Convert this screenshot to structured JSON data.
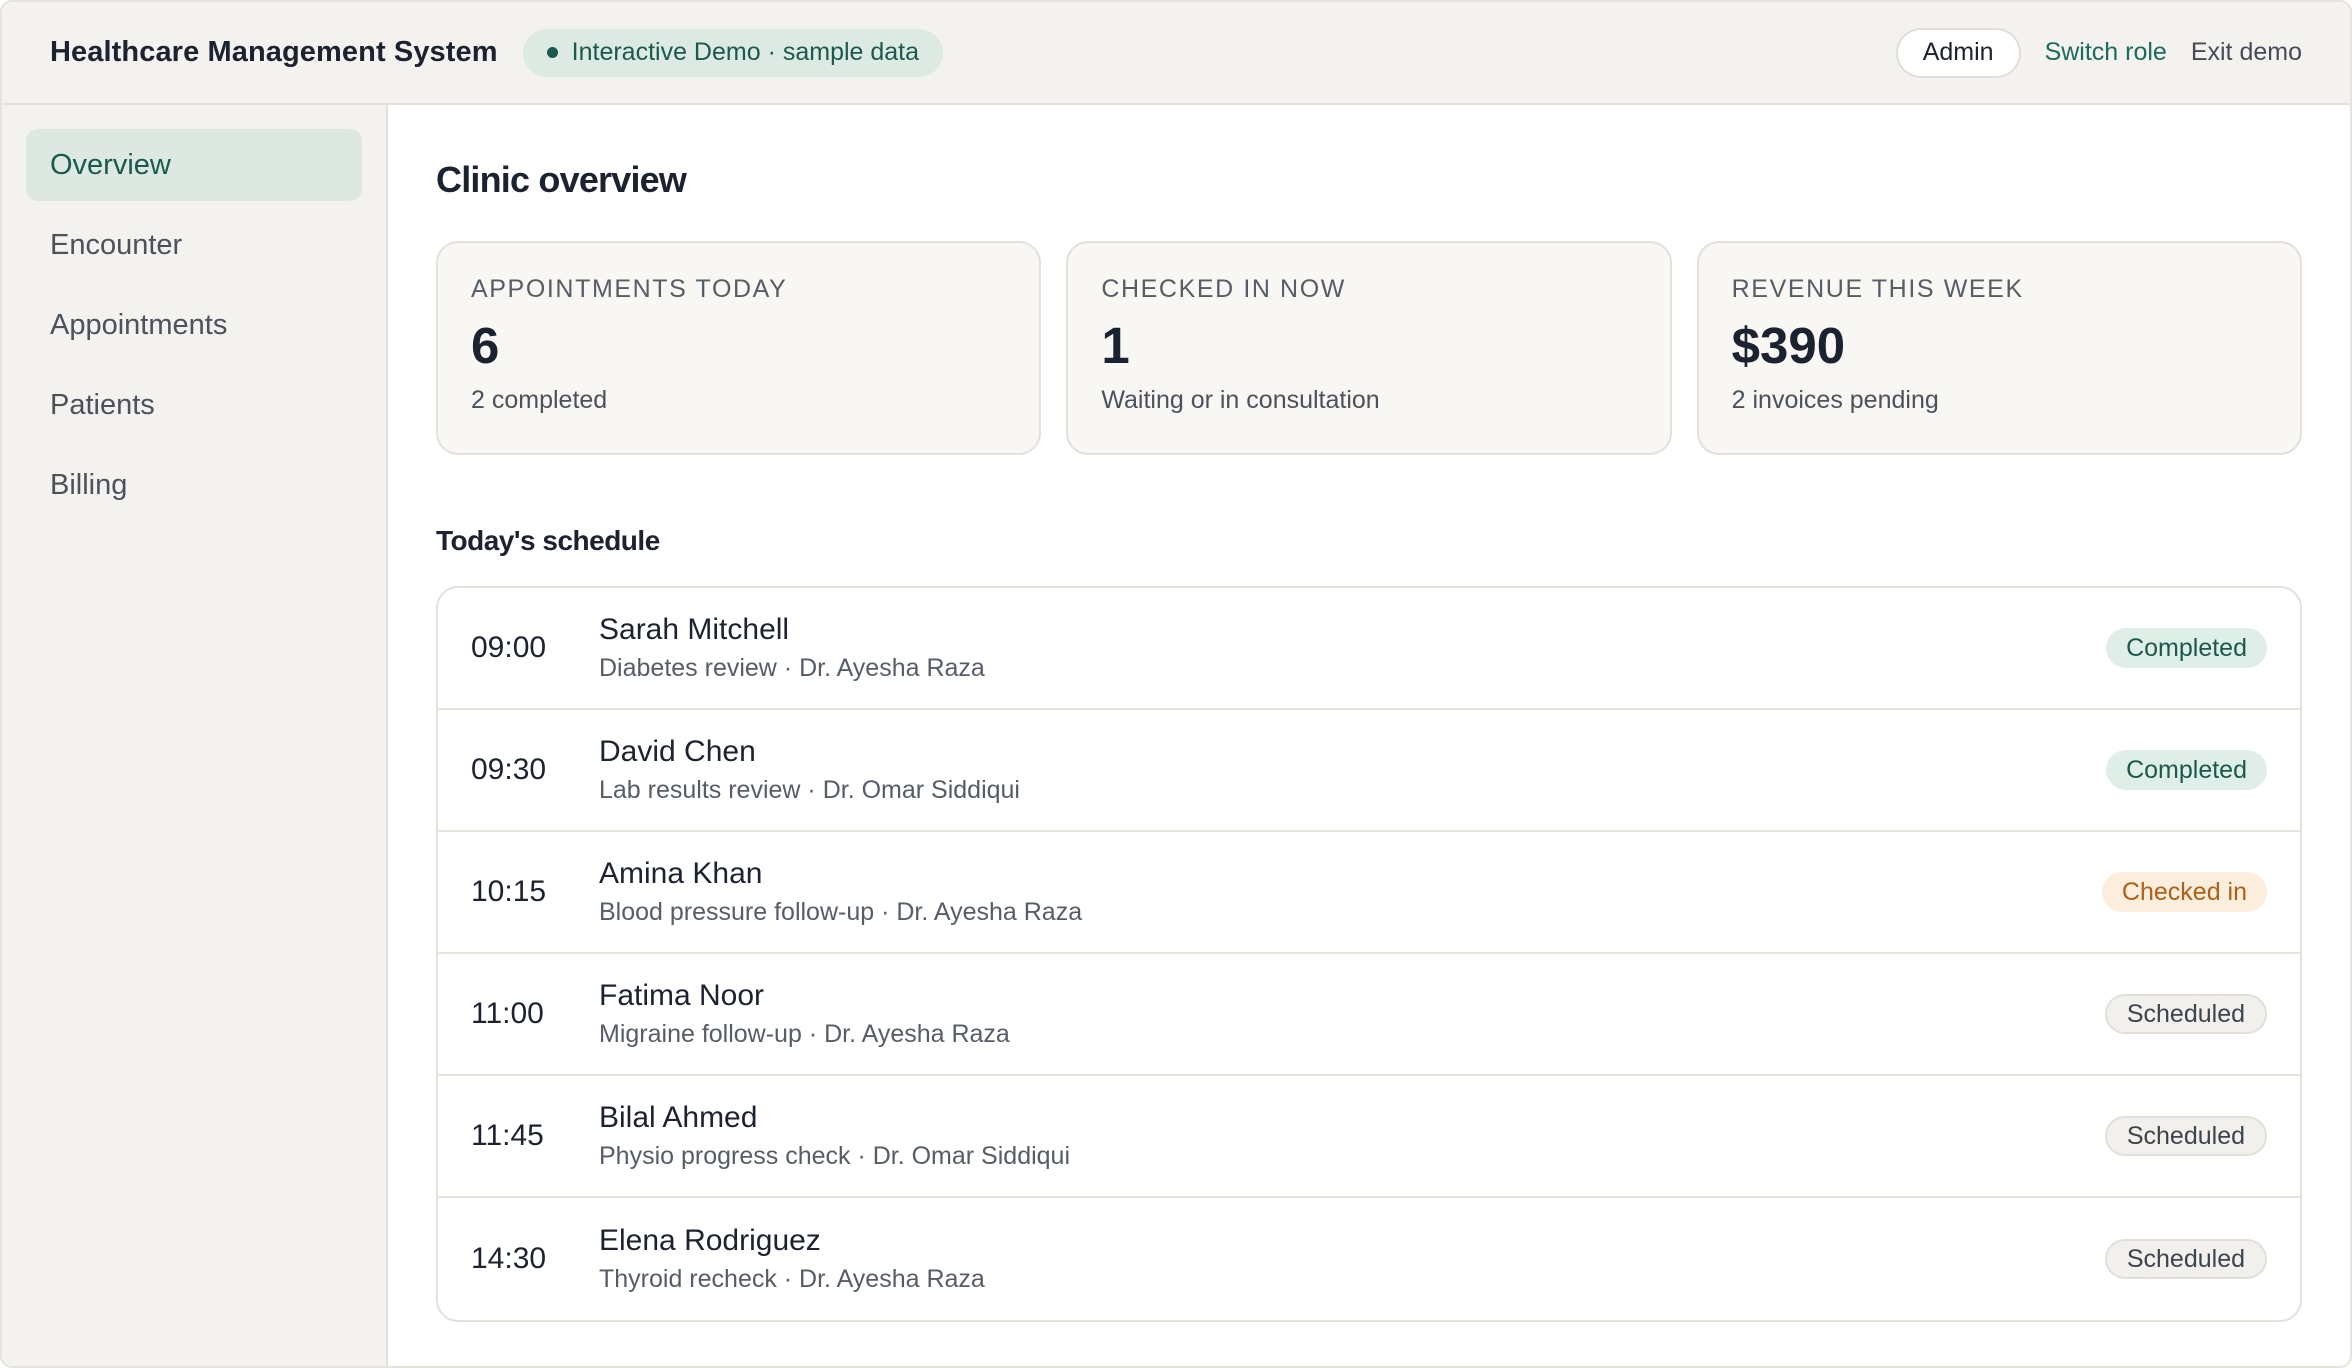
{
  "header": {
    "title": "Healthcare Management System",
    "demo_badge": "Interactive Demo · sample data",
    "role": "Admin",
    "switch_role": "Switch role",
    "exit_demo": "Exit demo"
  },
  "sidebar": {
    "items": [
      {
        "label": "Overview",
        "active": true
      },
      {
        "label": "Encounter",
        "active": false
      },
      {
        "label": "Appointments",
        "active": false
      },
      {
        "label": "Patients",
        "active": false
      },
      {
        "label": "Billing",
        "active": false
      }
    ]
  },
  "main": {
    "title": "Clinic overview",
    "cards": [
      {
        "label": "Appointments today",
        "value": "6",
        "sub": "2 completed"
      },
      {
        "label": "Checked in now",
        "value": "1",
        "sub": "Waiting or in consultation"
      },
      {
        "label": "Revenue this week",
        "value": "$390",
        "sub": "2 invoices pending"
      }
    ],
    "schedule_title": "Today's schedule",
    "schedule": [
      {
        "time": "09:00",
        "name": "Sarah Mitchell",
        "desc": "Diabetes review · Dr. Ayesha Raza",
        "status": "Completed",
        "status_type": "completed"
      },
      {
        "time": "09:30",
        "name": "David Chen",
        "desc": "Lab results review · Dr. Omar Siddiqui",
        "status": "Completed",
        "status_type": "completed"
      },
      {
        "time": "10:15",
        "name": "Amina Khan",
        "desc": "Blood pressure follow-up · Dr. Ayesha Raza",
        "status": "Checked in",
        "status_type": "checked"
      },
      {
        "time": "11:00",
        "name": "Fatima Noor",
        "desc": "Migraine follow-up · Dr. Ayesha Raza",
        "status": "Scheduled",
        "status_type": "scheduled"
      },
      {
        "time": "11:45",
        "name": "Bilal Ahmed",
        "desc": "Physio progress check · Dr. Omar Siddiqui",
        "status": "Scheduled",
        "status_type": "scheduled"
      },
      {
        "time": "14:30",
        "name": "Elena Rodriguez",
        "desc": "Thyroid recheck · Dr. Ayesha Raza",
        "status": "Scheduled",
        "status_type": "scheduled"
      }
    ]
  },
  "colors": {
    "accent": "#1a5a4d",
    "completed_bg": "#e0eee8",
    "checked_text": "#b05f15",
    "checked_bg": "#fbeedd",
    "scheduled_bg": "#f1f0ec"
  }
}
